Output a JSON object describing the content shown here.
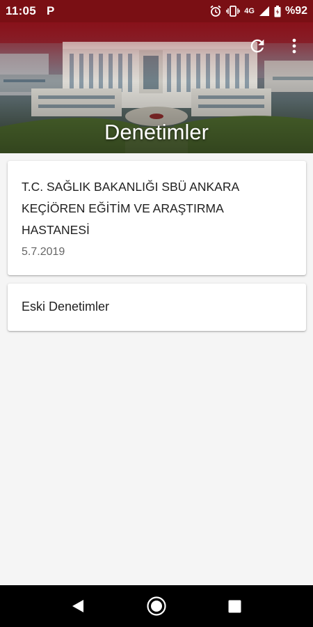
{
  "status_bar": {
    "time": "11:05",
    "p_icon_label": "P",
    "network_label": "4G",
    "battery_label": "%92",
    "icons": [
      "alarm-icon",
      "vibrate-icon",
      "signal-icon",
      "battery-icon"
    ],
    "background": "#7a0f14"
  },
  "header": {
    "title": "Denetimler",
    "actions": [
      "refresh-icon",
      "more-vert-icon"
    ]
  },
  "inspections": [
    {
      "title": "T.C. SAĞLIK BAKANLIĞI SBÜ ANKARA KEÇİÖREN EĞİTİM VE ARAŞTIRMA HASTANESİ",
      "date": "5.7.2019"
    }
  ],
  "old_inspections_label": "Eski Denetimler",
  "nav_bar": {
    "buttons": [
      "back-icon",
      "home-icon",
      "recents-icon"
    ]
  }
}
